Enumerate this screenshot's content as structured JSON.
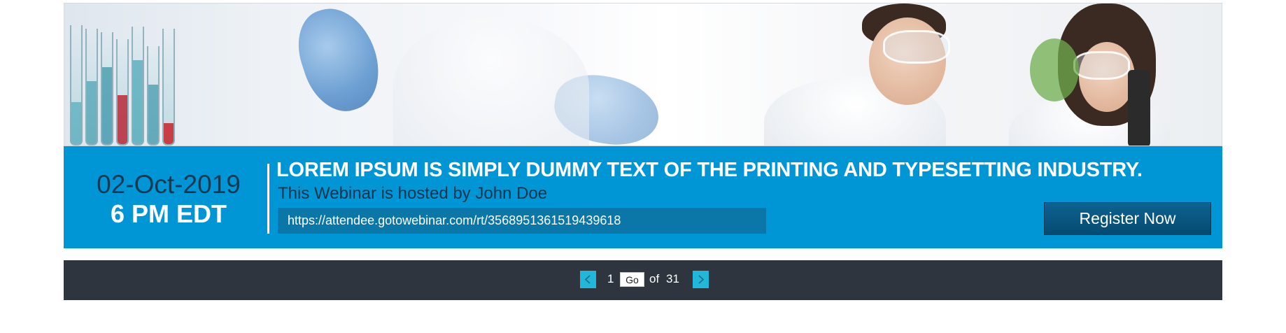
{
  "event": {
    "date": "02-Oct-2019",
    "time": "6 PM EDT",
    "headline": "LOREM IPSUM IS SIMPLY DUMMY TEXT OF THE PRINTING AND TYPESETTING INDUSTRY.",
    "host_text": "This Webinar is hosted by John Doe",
    "url": "https://attendee.gotowebinar.com/rt/3568951361519439618",
    "register_label": "Register Now"
  },
  "pager": {
    "current_page": "1",
    "go_label": "Go",
    "of_label": "of",
    "total_pages": "31",
    "prev_icon": "chevron-left-icon",
    "next_icon": "chevron-right-icon"
  },
  "colors": {
    "info_bar": "#0096d6",
    "register_button": "#06537d",
    "pager_bar": "#2f353e",
    "pager_arrow": "#22b7d9"
  }
}
